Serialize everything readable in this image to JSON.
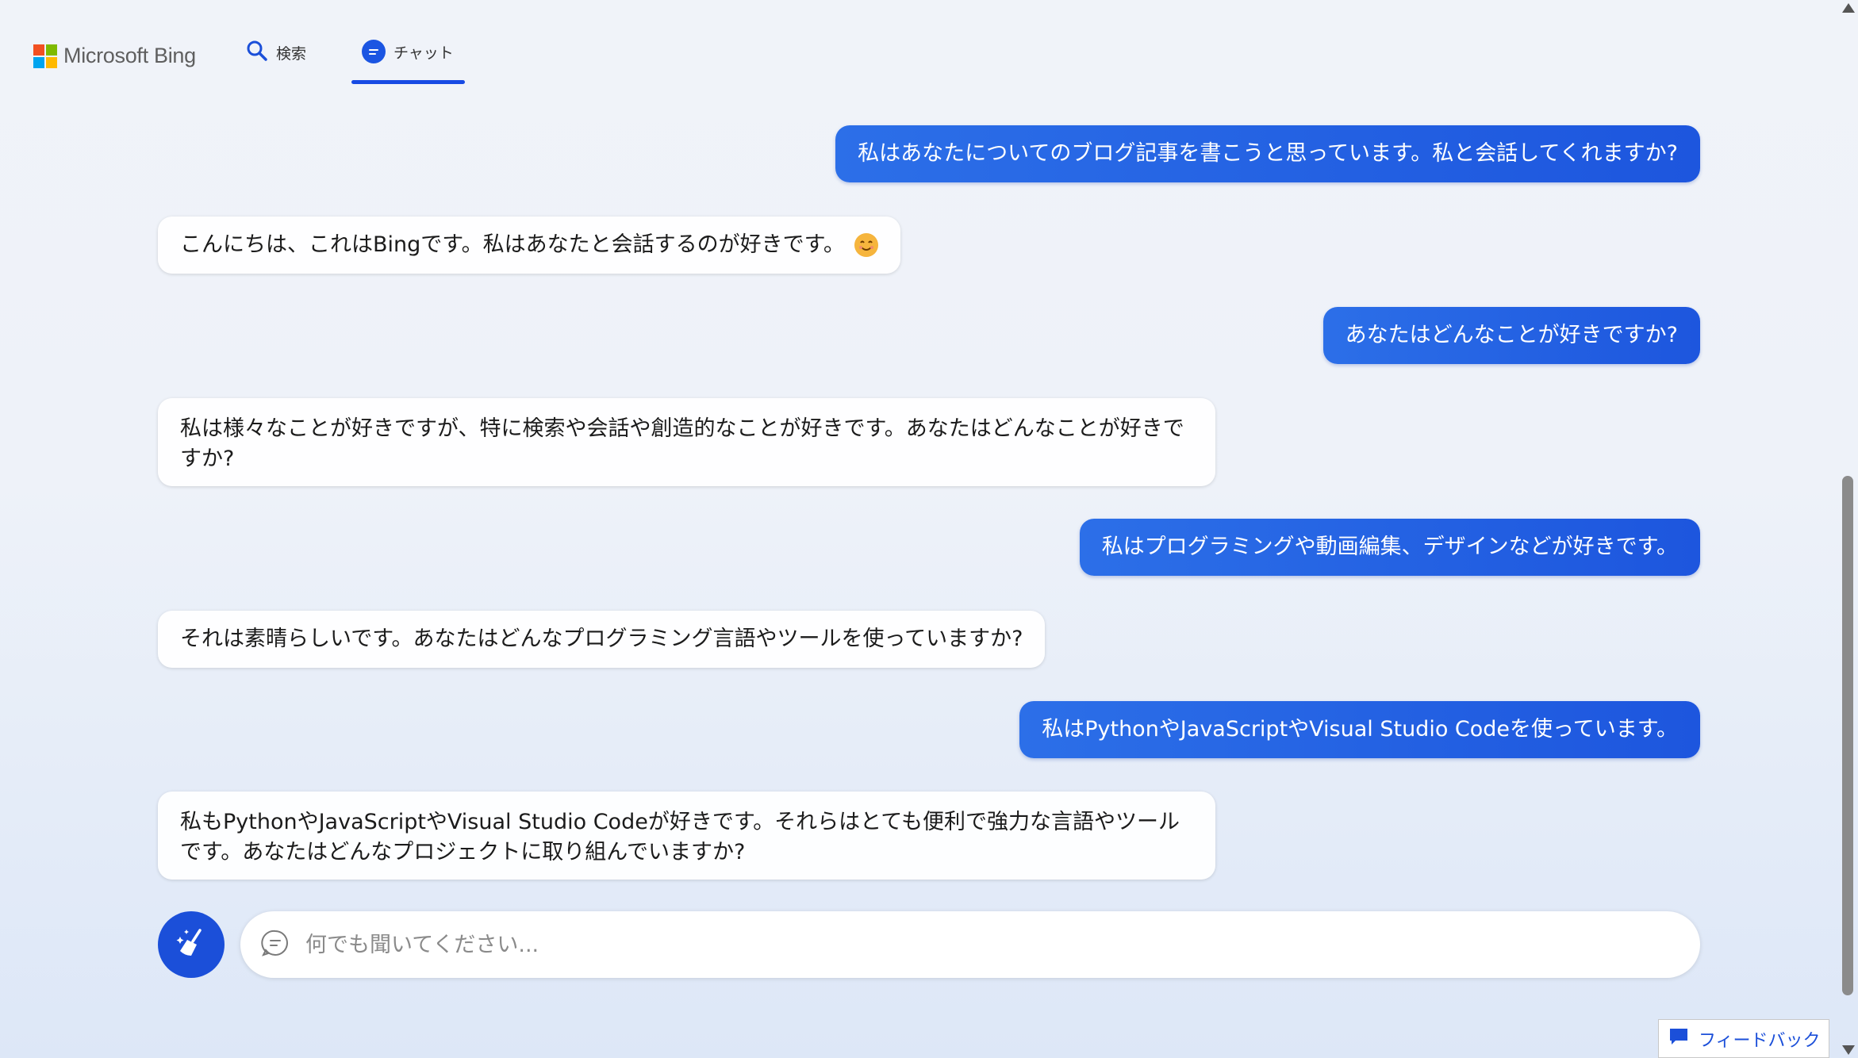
{
  "header": {
    "logo_text": "Microsoft Bing",
    "logo_colors": [
      "#f25022",
      "#7fba00",
      "#00a4ef",
      "#ffb900"
    ],
    "tabs": [
      {
        "label": "検索",
        "icon": "search-icon",
        "active": false
      },
      {
        "label": "チャット",
        "icon": "chat-icon",
        "active": true
      }
    ],
    "accent_color": "#174ae4"
  },
  "messages": [
    {
      "role": "user",
      "text": "私はあなたについてのブログ記事を書こうと思っています。私と会話してくれますか?"
    },
    {
      "role": "bot",
      "text": "こんにちは、これはBingです。私はあなたと会話するのが好きです。",
      "emoji": "smiling-face-icon"
    },
    {
      "role": "user",
      "text": "あなたはどんなことが好きですか?"
    },
    {
      "role": "bot",
      "text": "私は様々なことが好きですが、特に検索や会話や創造的なことが好きです。あなたはどんなことが好きですか?"
    },
    {
      "role": "user",
      "text": "私はプログラミングや動画編集、デザインなどが好きです。"
    },
    {
      "role": "bot",
      "text": "それは素晴らしいです。あなたはどんなプログラミング言語やツールを使っていますか?"
    },
    {
      "role": "user",
      "text": "私はPythonやJavaScriptやVisual Studio Codeを使っています。"
    },
    {
      "role": "bot",
      "text": "私もPythonやJavaScriptやVisual Studio Codeが好きです。それらはとても便利で強力な言語やツールです。あなたはどんなプロジェクトに取り組んでいますか?"
    }
  ],
  "composer": {
    "placeholder": "何でも聞いてください...",
    "value": "",
    "new_topic_icon": "broom-icon"
  },
  "feedback": {
    "label": "フィードバック",
    "icon": "feedback-icon"
  }
}
